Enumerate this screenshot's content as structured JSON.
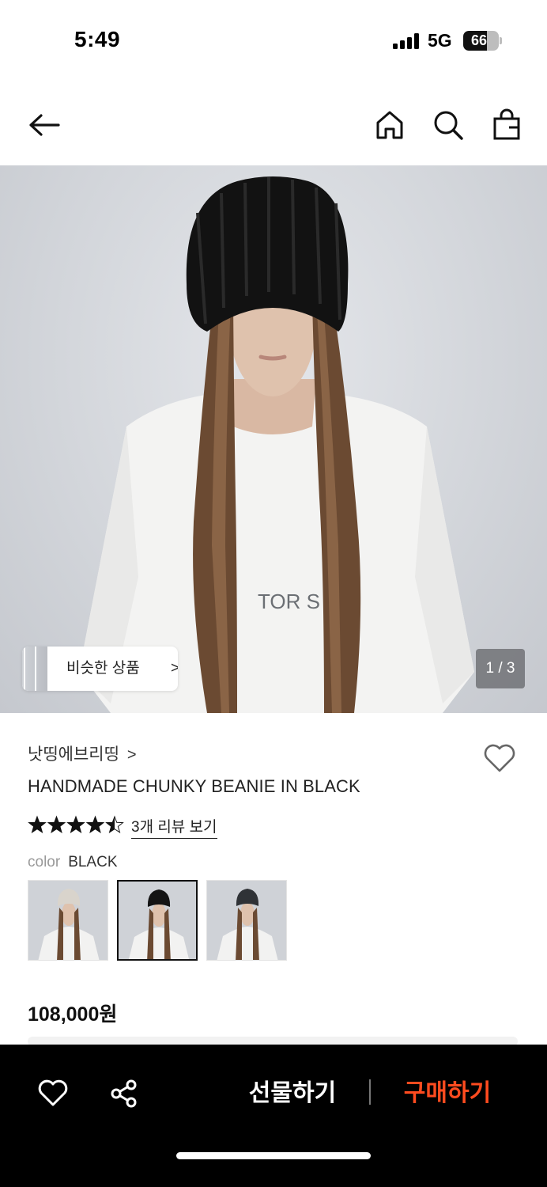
{
  "status_bar": {
    "time": "5:49",
    "network": "5G",
    "battery": "66",
    "battery_level": 0.66
  },
  "nav": {
    "icons": [
      "back-arrow-icon",
      "home-icon",
      "search-icon",
      "shopping-bag-icon"
    ]
  },
  "hero": {
    "shirt_print": "TOR S",
    "similar_products_label": "비슷한 상품",
    "similar_products_chevron": ">",
    "page_counter": "1 / 3"
  },
  "product": {
    "brand": "낫띵에브리띵",
    "brand_chevron": ">",
    "title": "HANDMADE CHUNKY BEANIE IN BLACK",
    "rating": 4.5,
    "review_link": "3개 리뷰 보기",
    "color_label": "color",
    "color_value": "BLACK",
    "swatches": [
      {
        "name": "ivory",
        "hat_color": "#d9d4cc",
        "selected": false
      },
      {
        "name": "black",
        "hat_color": "#141414",
        "selected": true
      },
      {
        "name": "charcoal",
        "hat_color": "#2f3236",
        "selected": false
      }
    ],
    "price": "108,000원"
  },
  "bottom_bar": {
    "gift_label": "선물하기",
    "buy_label": "구매하기",
    "buy_color": "#ff4b1f",
    "icons": [
      "heart-icon",
      "share-icon"
    ]
  }
}
